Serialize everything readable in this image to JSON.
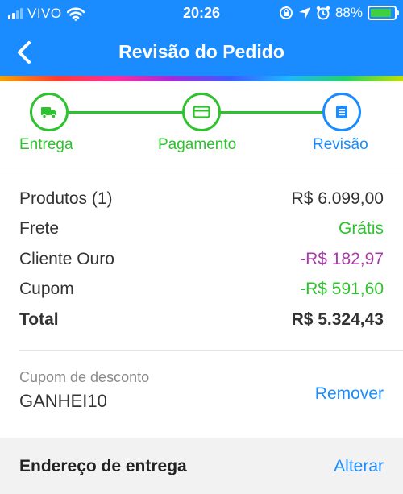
{
  "status_bar": {
    "carrier": "VIVO",
    "time": "20:26",
    "battery": "88%",
    "battery_level": 0.88,
    "icons": [
      "signal-icon",
      "wifi-icon",
      "lock-rotation-icon",
      "location-icon",
      "alarm-icon",
      "battery-charging-icon"
    ]
  },
  "header": {
    "title": "Revisão do Pedido",
    "back_icon": "chevron-left-icon",
    "background": "#1a8cff"
  },
  "steps": [
    {
      "label": "Entrega",
      "icon": "truck-icon",
      "color": "#2ec22e"
    },
    {
      "label": "Pagamento",
      "icon": "credit-card-icon",
      "color": "#2ec22e"
    },
    {
      "label": "Revisão",
      "icon": "document-icon",
      "color": "#1a8cff"
    }
  ],
  "summary": {
    "products_label": "Produtos (1)",
    "products_value": "R$ 6.099,00",
    "shipping_label": "Frete",
    "shipping_value": "Grátis",
    "gold_label": "Cliente Ouro",
    "gold_value": "-R$ 182,97",
    "coupon_label": "Cupom",
    "coupon_value": "-R$ 591,60",
    "total_label": "Total",
    "total_value": "R$ 5.324,43"
  },
  "coupon": {
    "label": "Cupom de desconto",
    "code": "GANHEI10",
    "remove_label": "Remover"
  },
  "address": {
    "title": "Endereço de entrega",
    "change_label": "Alterar"
  },
  "colors": {
    "primary": "#1a8cff",
    "success": "#2ec22e",
    "gold": "#a83ca8"
  }
}
